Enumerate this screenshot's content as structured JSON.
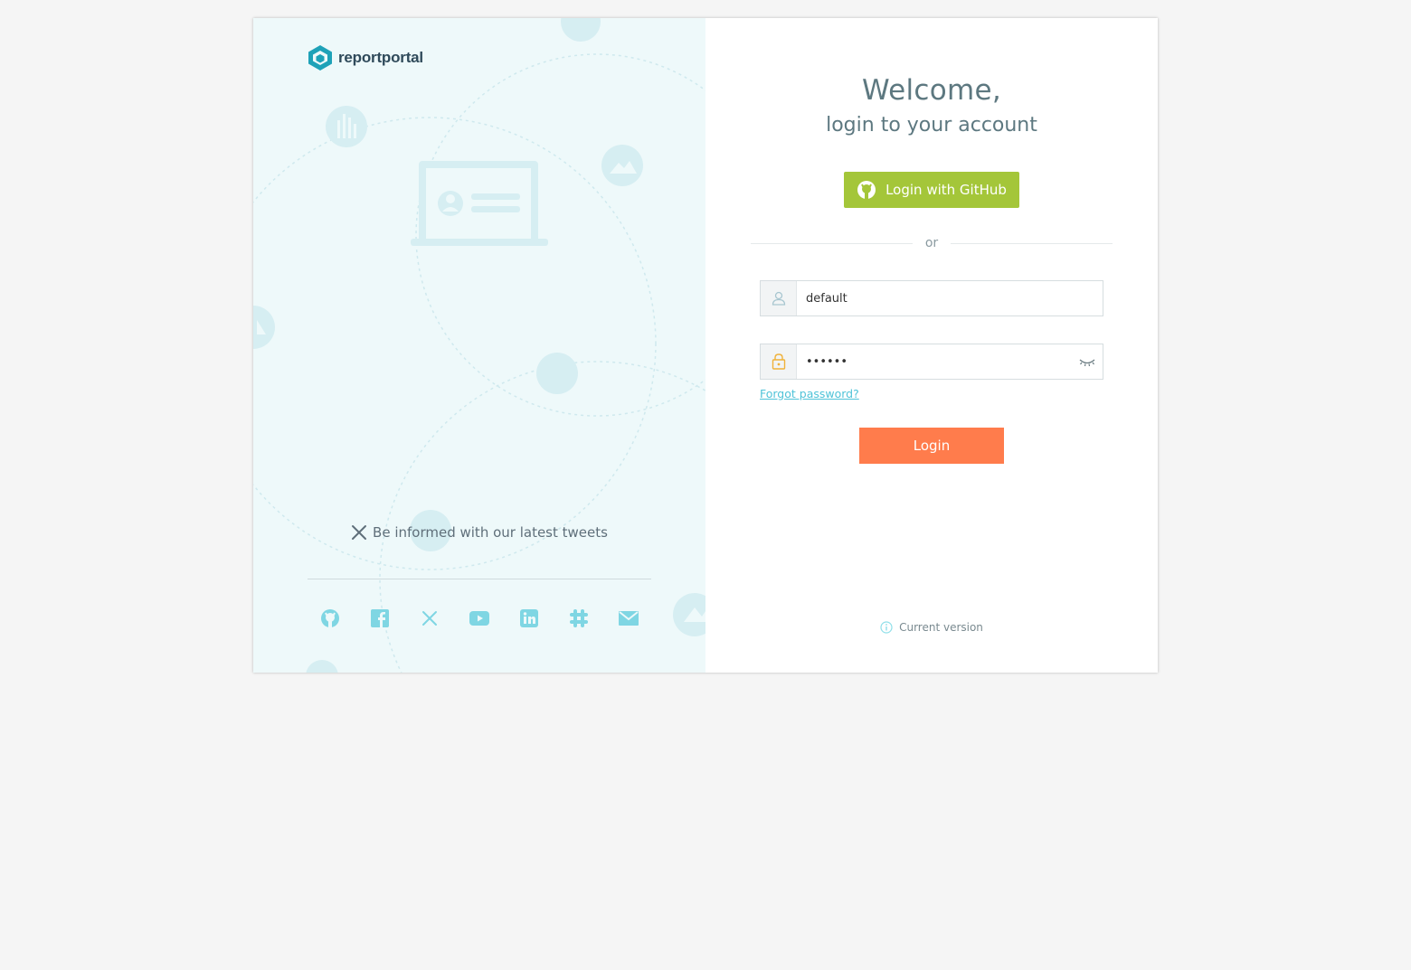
{
  "brand": {
    "name": "reportportal",
    "logo_icon": "hexagon-logo-icon"
  },
  "left_panel": {
    "tweets_text": "Be informed with our latest tweets",
    "tweets_icon": "x-icon",
    "social_links": [
      {
        "name": "github",
        "icon": "github-icon"
      },
      {
        "name": "facebook",
        "icon": "facebook-icon"
      },
      {
        "name": "x",
        "icon": "x-icon"
      },
      {
        "name": "youtube",
        "icon": "youtube-icon"
      },
      {
        "name": "linkedin",
        "icon": "linkedin-icon"
      },
      {
        "name": "slack",
        "icon": "slack-icon"
      },
      {
        "name": "email",
        "icon": "mail-icon"
      }
    ]
  },
  "login": {
    "welcome": "Welcome,",
    "subtitle": "login to your account",
    "github_button": "Login with GitHub",
    "or_text": "or",
    "username_value": "default",
    "password_value": "••••••",
    "forgot_password": "Forgot password?",
    "login_button": "Login",
    "current_version": "Current version"
  },
  "colors": {
    "github_button": "#a4c639",
    "login_button": "#ff7c4c",
    "link": "#4fc3d8",
    "left_panel_bg": "#eef9fa",
    "accent_teal": "#1ea2b8"
  }
}
